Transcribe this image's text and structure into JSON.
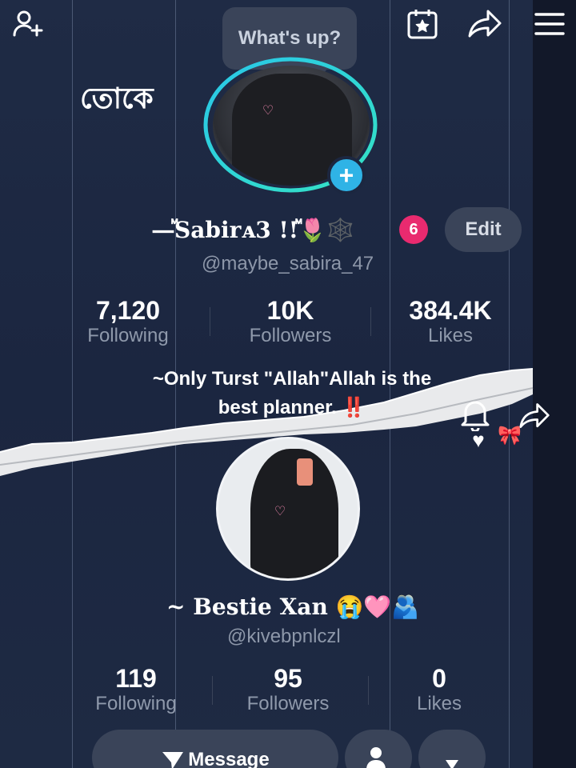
{
  "bubble_text": "What's up?",
  "bangla_text": "তোকে",
  "profile": {
    "display_name": "—ⷨ𝐒𝐚𝐛𝐢𝐫ᴀ𝟑 !!ⷨ🌷🕸️",
    "badge_count": "6",
    "edit_label": "Edit",
    "username": "@maybe_sabira_47",
    "stats": [
      {
        "value": "7,120",
        "label": "Following"
      },
      {
        "value": "10K",
        "label": "Followers"
      },
      {
        "value": "384.4K",
        "label": "Likes"
      }
    ],
    "bio_line1": "~Only Turst \"Allah\"Allah is the",
    "bio_line2": "best planner. ‼️"
  },
  "bestie": {
    "display_name": "~ Bestie Xan 😭🩷🫂",
    "username": "@kivebpnlczl",
    "stats": [
      {
        "value": "119",
        "label": "Following"
      },
      {
        "value": "95",
        "label": "Followers"
      },
      {
        "value": "0",
        "label": "Likes"
      }
    ],
    "message_label": "Message"
  },
  "icons": {
    "add_user": "add-user-icon",
    "calendar_star": "calendar-star-icon",
    "share": "share-icon",
    "menu": "menu-icon",
    "bell": "bell-icon",
    "chevron_down": "chevron-down-icon"
  },
  "colors": {
    "background": "#1c2740",
    "button": "#3a4459",
    "badge": "#e92a6f",
    "plus": "#2fb3e6",
    "ring_start": "#29c7e8",
    "ring_end": "#35e2c4"
  }
}
